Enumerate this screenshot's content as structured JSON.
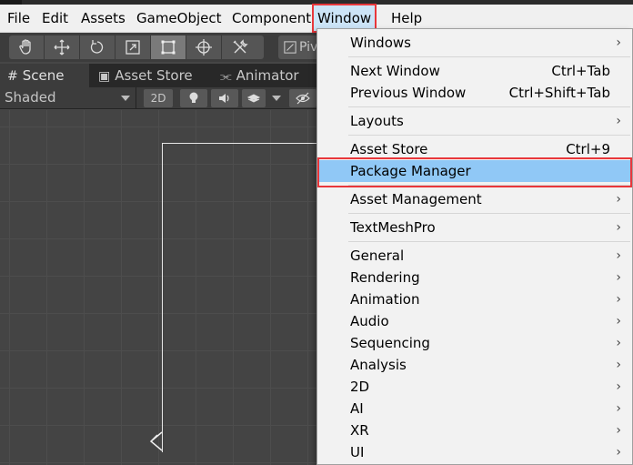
{
  "menubar": {
    "items": [
      "File",
      "Edit",
      "Assets",
      "GameObject",
      "Component",
      "Window",
      "Help"
    ],
    "active": "Window"
  },
  "toolbar": {
    "tools": [
      "hand-tool",
      "move-tool",
      "rotate-tool",
      "scale-tool",
      "rect-tool",
      "transform-tool",
      "custom-tool"
    ],
    "selected_tool": "rect-tool",
    "pivot_label": "Piv"
  },
  "tabs": [
    {
      "label": "Scene",
      "icon": "#"
    },
    {
      "label": "Asset Store",
      "icon": "▣"
    },
    {
      "label": "Animator",
      "icon": "⫘"
    }
  ],
  "scene_toolbar": {
    "shading_mode": "Shaded",
    "mode_2d": "2D"
  },
  "window_menu": {
    "items": [
      {
        "label": "Windows",
        "submenu": true
      },
      {
        "label": "Next Window",
        "shortcut": "Ctrl+Tab"
      },
      {
        "label": "Previous Window",
        "shortcut": "Ctrl+Shift+Tab"
      },
      {
        "label": "Layouts",
        "submenu": true
      },
      {
        "label": "Asset Store",
        "shortcut": "Ctrl+9"
      },
      {
        "label": "Package Manager",
        "highlighted": true
      },
      {
        "label": "Asset Management",
        "submenu": true
      },
      {
        "label": "TextMeshPro",
        "submenu": true
      },
      {
        "label": "General",
        "submenu": true
      },
      {
        "label": "Rendering",
        "submenu": true
      },
      {
        "label": "Animation",
        "submenu": true
      },
      {
        "label": "Audio",
        "submenu": true
      },
      {
        "label": "Sequencing",
        "submenu": true
      },
      {
        "label": "Analysis",
        "submenu": true
      },
      {
        "label": "2D",
        "submenu": true
      },
      {
        "label": "AI",
        "submenu": true
      },
      {
        "label": "XR",
        "submenu": true
      },
      {
        "label": "UI",
        "submenu": true
      }
    ]
  },
  "colors": {
    "highlight": "#90c8f6",
    "annotation_red": "#e8373b",
    "menu_bg": "#f2f2f2"
  }
}
